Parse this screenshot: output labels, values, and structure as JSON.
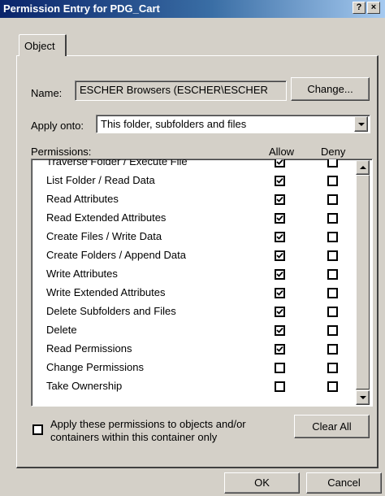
{
  "window": {
    "title": "Permission Entry for PDG_Cart",
    "help_label": "?",
    "close_label": "×"
  },
  "tabs": [
    {
      "label": "Object"
    }
  ],
  "name": {
    "label": "Name:",
    "value": "ESCHER Browsers (ESCHER\\ESCHER",
    "change_label": "Change..."
  },
  "apply_onto": {
    "label": "Apply onto:",
    "value": "This folder, subfolders and files"
  },
  "permissions": {
    "header_label": "Permissions:",
    "allow_header": "Allow",
    "deny_header": "Deny",
    "items": [
      {
        "label": "Traverse Folder / Execute File",
        "allow": true,
        "deny": false
      },
      {
        "label": "List Folder / Read Data",
        "allow": true,
        "deny": false
      },
      {
        "label": "Read Attributes",
        "allow": true,
        "deny": false
      },
      {
        "label": "Read Extended Attributes",
        "allow": true,
        "deny": false
      },
      {
        "label": "Create Files / Write Data",
        "allow": true,
        "deny": false
      },
      {
        "label": "Create Folders / Append Data",
        "allow": true,
        "deny": false
      },
      {
        "label": "Write Attributes",
        "allow": true,
        "deny": false
      },
      {
        "label": "Write Extended Attributes",
        "allow": true,
        "deny": false
      },
      {
        "label": "Delete Subfolders and Files",
        "allow": true,
        "deny": false
      },
      {
        "label": "Delete",
        "allow": true,
        "deny": false
      },
      {
        "label": "Read Permissions",
        "allow": true,
        "deny": false
      },
      {
        "label": "Change Permissions",
        "allow": false,
        "deny": false
      },
      {
        "label": "Take Ownership",
        "allow": false,
        "deny": false
      }
    ]
  },
  "apply_containers": {
    "checked": false,
    "label_line1": "Apply these permissions to objects and/or",
    "label_line2": "containers within this container only"
  },
  "clear_all_label": "Clear All",
  "ok_label": "OK",
  "cancel_label": "Cancel",
  "colors": {
    "title_start": "#0a246a",
    "title_end": "#a6caf0",
    "face": "#d4d0c8"
  }
}
